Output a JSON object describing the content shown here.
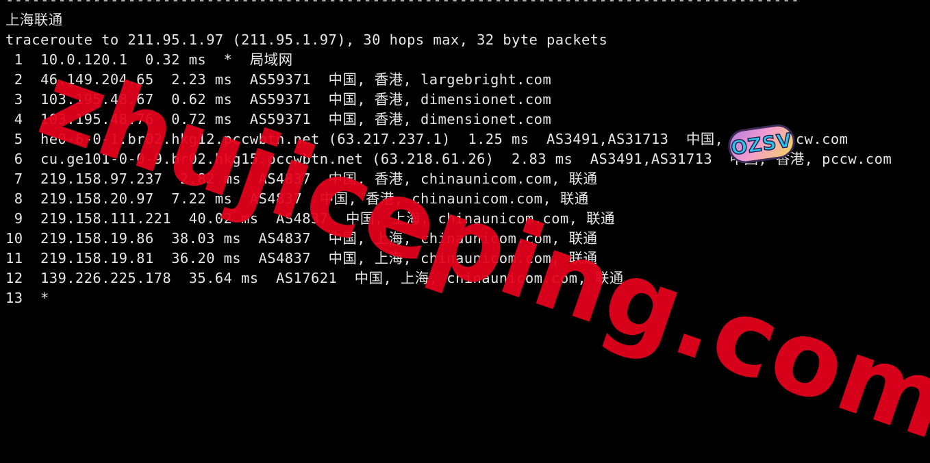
{
  "terminal": {
    "lines": [
      "-------------------------------------------------------------------------------------------",
      "上海联通",
      "traceroute to 211.95.1.97 (211.95.1.97), 30 hops max, 32 byte packets",
      " 1  10.0.120.1  0.32 ms  *  局域网",
      " 2  46.149.204.65  2.23 ms  AS59371  中国, 香港, largebright.com",
      " 3  103.195.48.67  0.62 ms  AS59371  中国, 香港, dimensionet.com",
      " 4  103.195.48.76  0.72 ms  AS59371  中国, 香港, dimensionet.com",
      " 5  he0-6-0-1.br02.hkg12.pccwbtn.net (63.217.237.1)  1.25 ms  AS3491,AS31713  中国, 香港, pccw.com",
      " 6  cu.ge101-0-0-9.br02.hkg15.pccwbtn.net (63.218.61.26)  2.83 ms  AS3491,AS31713  中国, 香港, pccw.com",
      " 7  219.158.97.237  2.82 ms  AS4837  中国, 香港, chinaunicom.com, 联通",
      " 8  219.158.20.97  7.22 ms  AS4837  中国, 香港, chinaunicom.com, 联通",
      " 9  219.158.111.221  40.02 ms  AS4837  中国, 上海, chinaunicom.com, 联通",
      "10  219.158.19.86  38.03 ms  AS4837  中国, 上海, chinaunicom.com, 联通",
      "11  219.158.19.81  36.20 ms  AS4837  中国, 上海, chinaunicom.com, 联通",
      "12  139.226.225.178  35.64 ms  AS17621  中国, 上海, chinaunicom.com, 联通",
      "13  *"
    ]
  },
  "watermark": {
    "text": "zhujiceping.com",
    "color": "#e8001c"
  },
  "logo": {
    "text": "OZSV"
  }
}
